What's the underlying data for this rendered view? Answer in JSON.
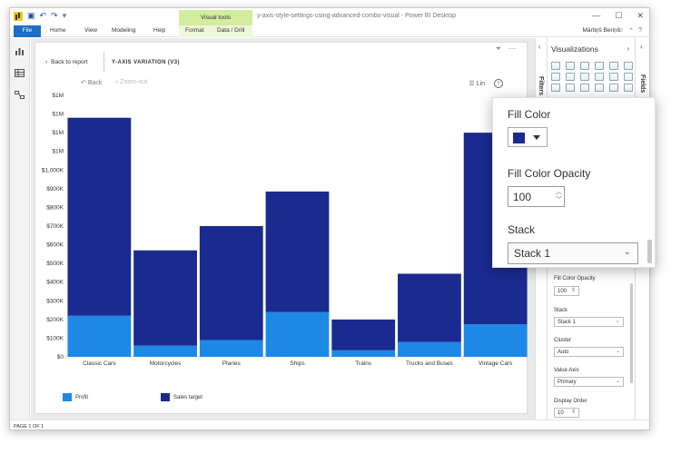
{
  "window": {
    "title": "y-axis-style-settings-using-advanced-combo-visual - Power BI Desktop",
    "context_tab_group": "Visual tools",
    "user": "Mārtiņš Beriņš"
  },
  "ribbon": {
    "file": "File",
    "tabs": [
      "Home",
      "View",
      "Modeling",
      "Help",
      "Format",
      "Data / Drill"
    ]
  },
  "report": {
    "back_to_report": "Back to report",
    "visual_title": "Y-AXIS VARIATION (V3)",
    "back": "Back",
    "zoom_out": "Zoom-out",
    "lin": "Lin"
  },
  "chart_data": {
    "type": "bar",
    "stacked": true,
    "categories": [
      "Classic Cars",
      "Motorcycles",
      "Planes",
      "Ships",
      "Trains",
      "Trucks and Buses",
      "Vintage Cars"
    ],
    "series": [
      {
        "name": "Profit",
        "values": [
          220000,
          60000,
          90000,
          240000,
          35000,
          80000,
          175000
        ],
        "color": "#1e88e5"
      },
      {
        "name": "Sales target",
        "values": [
          1060000,
          510000,
          610000,
          645000,
          165000,
          365000,
          1025000
        ],
        "color": "#1a2a8f"
      }
    ],
    "y_tick_labels": [
      "$0",
      "$100K",
      "$200K",
      "$300K",
      "$400K",
      "$500K",
      "$600K",
      "$700K",
      "$800K",
      "$900K",
      "$1,000K",
      "$1M",
      "$1M",
      "$1M",
      "$1M"
    ],
    "ylim": [
      0,
      1400000
    ],
    "grid": false,
    "legend_position": "bottom-left"
  },
  "filters_label": "Filters",
  "fields_label": "Fields",
  "viz_pane": {
    "title": "Visualizations",
    "fill_opacity_label": "Fill Color Opacity",
    "fill_opacity_value": "100",
    "stack_label": "Stack",
    "stack_value": "Stack 1",
    "cluster_label": "Cluster",
    "cluster_value": "Auto",
    "value_axis_label": "Value Axis",
    "value_axis_value": "Primary",
    "display_order_label": "Display Order",
    "display_order_value": "10"
  },
  "popup": {
    "fill_color_label": "Fill Color",
    "fill_color": "#1a2a8f",
    "fill_opacity_label": "Fill Color Opacity",
    "fill_opacity_value": "100",
    "stack_label": "Stack",
    "stack_value": "Stack 1"
  },
  "status": "PAGE 1 OF 1"
}
